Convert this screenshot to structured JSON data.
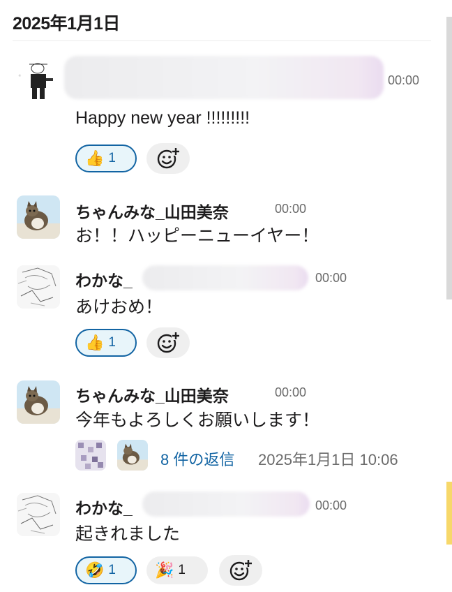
{
  "channel": {
    "date_header": "2025年1月1日"
  },
  "messages": [
    {
      "author": "",
      "time": "00:00",
      "text": "Happy new year !!!!!!!!!",
      "avatar_icon": "sketch-figure-icon",
      "reactions": [
        {
          "emoji": "thumbs-up",
          "count": "1",
          "active": true
        }
      ]
    },
    {
      "author": "ちゃんみな_山田美奈",
      "time": "00:00",
      "text": "お！！ハッピーニューイヤー！",
      "avatar_icon": "cat-photo-icon",
      "reactions": []
    },
    {
      "author": "わかな_",
      "time": "00:00",
      "text": "あけおめ！",
      "avatar_icon": "manga-drawing-icon",
      "reactions": [
        {
          "emoji": "thumbs-up",
          "count": "1",
          "active": true
        }
      ]
    },
    {
      "author": "ちゃんみな_山田美奈",
      "time": "00:00",
      "text": "今年もよろしくお願いします！",
      "avatar_icon": "cat-photo-icon",
      "thread": {
        "replies_label": "8 件の返信",
        "last_reply": "2025年1月1日 10:06"
      }
    },
    {
      "author": "わかな_",
      "time": "00:00",
      "text": "起きれました",
      "avatar_icon": "manga-drawing-icon",
      "reactions": [
        {
          "emoji": "rolling-laughing",
          "count": "1",
          "active": true
        },
        {
          "emoji": "party-popper",
          "count": "1",
          "active": false
        }
      ]
    }
  ],
  "colors": {
    "link": "#1264a3",
    "reaction_active_bg": "#e8f5fa",
    "reaction_border": "#1264a3",
    "muted_text": "#6b6b6b"
  }
}
